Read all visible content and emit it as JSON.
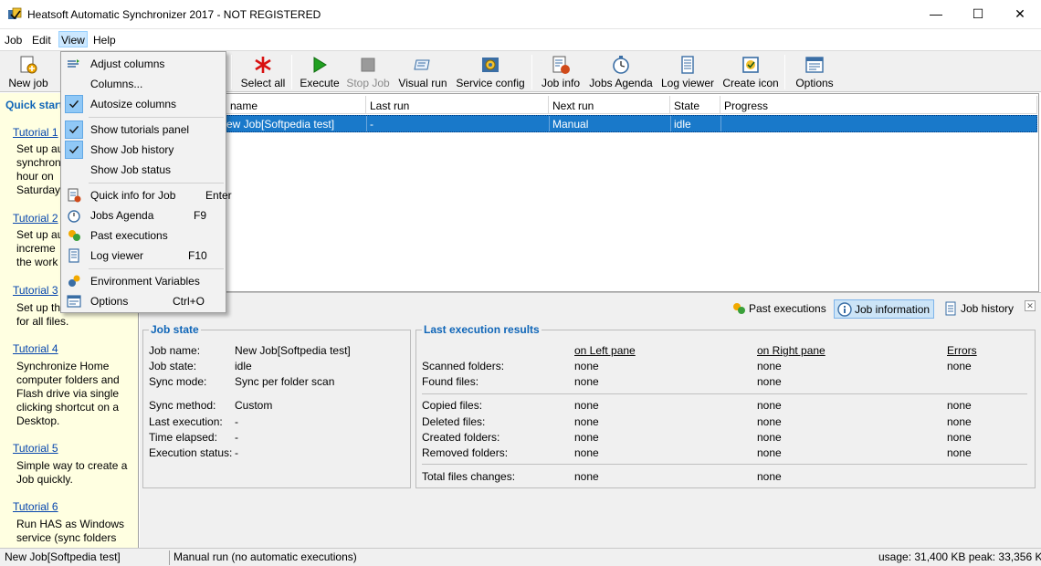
{
  "window": {
    "title": "Heatsoft Automatic Synchronizer 2017 - NOT REGISTERED",
    "minimize_glyph": "—",
    "maximize_glyph": "☐",
    "close_glyph": "✕"
  },
  "menubar": {
    "items": [
      {
        "label": "Job"
      },
      {
        "label": "Edit"
      },
      {
        "label": "View"
      },
      {
        "label": "Help"
      }
    ]
  },
  "toolbar": {
    "buttons": [
      {
        "label": "New job",
        "icon": "new-job-icon"
      },
      {
        "label": "Select all",
        "icon": "asterisk-icon"
      },
      {
        "label": "Execute",
        "icon": "play-icon"
      },
      {
        "label": "Stop Job",
        "icon": "stop-icon",
        "disabled": true
      },
      {
        "label": "Visual run",
        "icon": "visual-run-icon"
      },
      {
        "label": "Service config",
        "icon": "service-config-icon"
      },
      {
        "label": "Job info",
        "icon": "job-info-icon"
      },
      {
        "label": "Jobs Agenda",
        "icon": "stopwatch-icon"
      },
      {
        "label": "Log viewer",
        "icon": "log-viewer-icon"
      },
      {
        "label": "Create icon",
        "icon": "create-icon-icon"
      },
      {
        "label": "Options",
        "icon": "options-icon"
      }
    ]
  },
  "quickstart": {
    "title": "Quick start",
    "tutorials": [
      {
        "link": "Tutorial 1",
        "lines": [
          "Set up au",
          "synchron",
          "hour on",
          "Saturday"
        ]
      },
      {
        "link": "Tutorial 2",
        "lines": [
          "Set up au",
          "increme",
          "the work"
        ]
      },
      {
        "link": "Tutorial 3",
        "lines": [
          "Set up th",
          "for all files."
        ]
      },
      {
        "link": "Tutorial 4",
        "lines": [
          "Synchronize Home",
          "computer folders and",
          "Flash drive via single",
          "clicking shortcut on a",
          "Desktop."
        ]
      },
      {
        "link": "Tutorial 5",
        "lines": [
          "Simple way to create a",
          "Job quickly."
        ]
      },
      {
        "link": "Tutorial 6",
        "lines": [
          "Run HAS as Windows",
          "service (sync folders"
        ]
      }
    ]
  },
  "joblist": {
    "columns": [
      "name",
      "Last run",
      "Next run",
      "State",
      "Progress"
    ],
    "rows": [
      {
        "name": "ew Job[Softpedia test]",
        "last_run": "-",
        "next_run": "Manual",
        "state": "idle",
        "progress": ""
      }
    ]
  },
  "bottom_tabs": [
    {
      "label": "Past executions",
      "icon": "past-executions-icon",
      "active": false
    },
    {
      "label": "Job information",
      "icon": "info-icon",
      "active": true
    },
    {
      "label": "Job history",
      "icon": "job-history-icon",
      "active": false
    }
  ],
  "close_panel_glyph": "✕",
  "job_state": {
    "title": "Job state",
    "fields": [
      {
        "label": "Job name:",
        "value": "New Job[Softpedia test]"
      },
      {
        "label": "Job state:",
        "value": "idle"
      },
      {
        "label": "Sync mode:",
        "value": "Sync per folder scan"
      },
      {
        "label": "Sync method:",
        "value": "Custom"
      },
      {
        "label": "Last execution:",
        "value": "-"
      },
      {
        "label": "Time elapsed:",
        "value": "-"
      },
      {
        "label": "Execution status:",
        "value": "-"
      }
    ]
  },
  "last_results": {
    "title": "Last execution results",
    "headers": {
      "left": "on Left pane",
      "right": "on Right pane",
      "errors": "Errors"
    },
    "rows": [
      {
        "label": "Scanned folders:",
        "left": "none",
        "right": "none",
        "errors": "none"
      },
      {
        "label": "Found files:",
        "left": "none",
        "right": "none",
        "errors": ""
      },
      {
        "label": "Copied files:",
        "left": "none",
        "right": "none",
        "errors": "none"
      },
      {
        "label": "Deleted files:",
        "left": "none",
        "right": "none",
        "errors": "none"
      },
      {
        "label": "Created folders:",
        "left": "none",
        "right": "none",
        "errors": "none"
      },
      {
        "label": "Removed folders:",
        "left": "none",
        "right": "none",
        "errors": "none"
      },
      {
        "label": "Total files changes:",
        "left": "none",
        "right": "none",
        "errors": ""
      }
    ]
  },
  "statusbar": {
    "job": "New Job[Softpedia test]",
    "mode": "Manual run (no automatic executions)",
    "usage": "usage: 31,400 KB peak: 33,356 KB"
  },
  "view_menu": {
    "items": [
      {
        "label": "Adjust columns",
        "shortcut": "",
        "icon": "adjust-columns-icon",
        "checked": false
      },
      {
        "label": "Columns...",
        "shortcut": "",
        "icon": "",
        "checked": false
      },
      {
        "label": "Autosize columns",
        "shortcut": "",
        "icon": "",
        "checked": true
      },
      {
        "label": "Show tutorials panel",
        "shortcut": "",
        "icon": "",
        "checked": true
      },
      {
        "label": "Show Job history",
        "shortcut": "",
        "icon": "",
        "checked": true
      },
      {
        "label": "Show Job status",
        "shortcut": "",
        "icon": "",
        "checked": false
      },
      {
        "label": "Quick info for Job",
        "shortcut": "Enter",
        "icon": "job-info-icon",
        "checked": false
      },
      {
        "label": "Jobs Agenda",
        "shortcut": "F9",
        "icon": "stopwatch-icon",
        "checked": false
      },
      {
        "label": "Past executions",
        "shortcut": "",
        "icon": "past-executions-icon",
        "checked": false
      },
      {
        "label": "Log viewer",
        "shortcut": "F10",
        "icon": "log-viewer-icon",
        "checked": false
      },
      {
        "label": "Environment Variables",
        "shortcut": "",
        "icon": "environment-variables-icon",
        "checked": false
      },
      {
        "label": "Options",
        "shortcut": "Ctrl+O",
        "icon": "options-icon",
        "checked": false
      }
    ]
  },
  "colors": {
    "selection": "#1979ca",
    "link": "#0645ad",
    "group_title": "#1066b8",
    "tutorial_bg": "#ffffe1"
  }
}
